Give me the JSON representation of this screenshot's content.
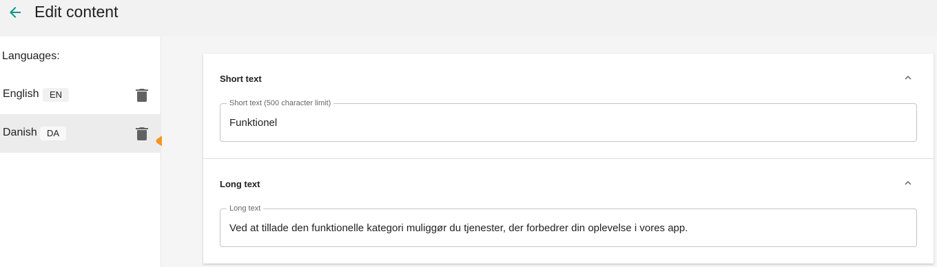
{
  "header": {
    "title": "Edit content"
  },
  "sidebar": {
    "heading": "Languages:",
    "languages": [
      {
        "name": "English",
        "code": "EN",
        "selected": false
      },
      {
        "name": "Danish",
        "code": "DA",
        "selected": true
      }
    ]
  },
  "short_text": {
    "title": "Short text",
    "field_label": "Short text (500 character limit)",
    "value": "Funktionel"
  },
  "long_text": {
    "title": "Long text",
    "field_label": "Long text",
    "value": "Ved at tillade den funktionelle kategori muliggør du tjenester, der forbedrer din oplevelse i vores app."
  },
  "colors": {
    "accent": "#009688",
    "annotation_arrow": "#f7941d",
    "icon": "#616161"
  },
  "icons": [
    "arrow-back-icon",
    "trash-icon",
    "chevron-up-icon"
  ]
}
